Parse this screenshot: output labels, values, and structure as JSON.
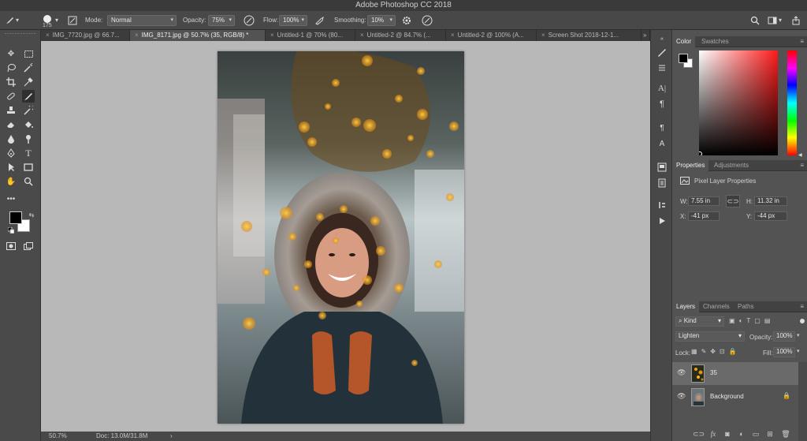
{
  "app": {
    "title": "Adobe Photoshop CC 2018"
  },
  "options": {
    "brush_size": "175",
    "mode_label": "Mode:",
    "mode_value": "Normal",
    "opacity_label": "Opacity:",
    "opacity_value": "75%",
    "flow_label": "Flow:",
    "flow_value": "100%",
    "smoothing_label": "Smoothing:",
    "smoothing_value": "10%"
  },
  "tabs": [
    "IMG_7720.jpg @ 66.7...",
    "IMG_8171.jpg @ 50.7% (35, RGB/8) *",
    "Untitled-1 @ 70% (80...",
    "Untitled-2 @ 84.7% (...",
    "Untitled-2 @ 100% (A...",
    "Screen Shot 2018-12-1..."
  ],
  "active_tab": 1,
  "status": {
    "zoom": "50.7%",
    "doc": "Doc: 13.0M/31.8M"
  },
  "color_panel": {
    "tab_color": "Color",
    "tab_swatches": "Swatches",
    "hue_color": "#ff1a1a"
  },
  "properties_panel": {
    "tab_properties": "Properties",
    "tab_adjustments": "Adjustments",
    "heading": "Pixel Layer Properties",
    "w_label": "W:",
    "w_value": "7.55 in",
    "h_label": "H:",
    "h_value": "11.32 in",
    "x_label": "X:",
    "x_value": "-41 px",
    "y_label": "Y:",
    "y_value": "-44 px"
  },
  "layers_panel": {
    "tab_layers": "Layers",
    "tab_channels": "Channels",
    "tab_paths": "Paths",
    "filter_kind": "Kind",
    "blend_mode": "Lighten",
    "opacity_label": "Opacity:",
    "opacity_value": "100%",
    "lock_label": "Lock:",
    "fill_label": "Fill:",
    "fill_value": "100%",
    "layers": [
      {
        "name": "35",
        "selected": true
      },
      {
        "name": "Background",
        "selected": false,
        "locked": true
      }
    ]
  }
}
